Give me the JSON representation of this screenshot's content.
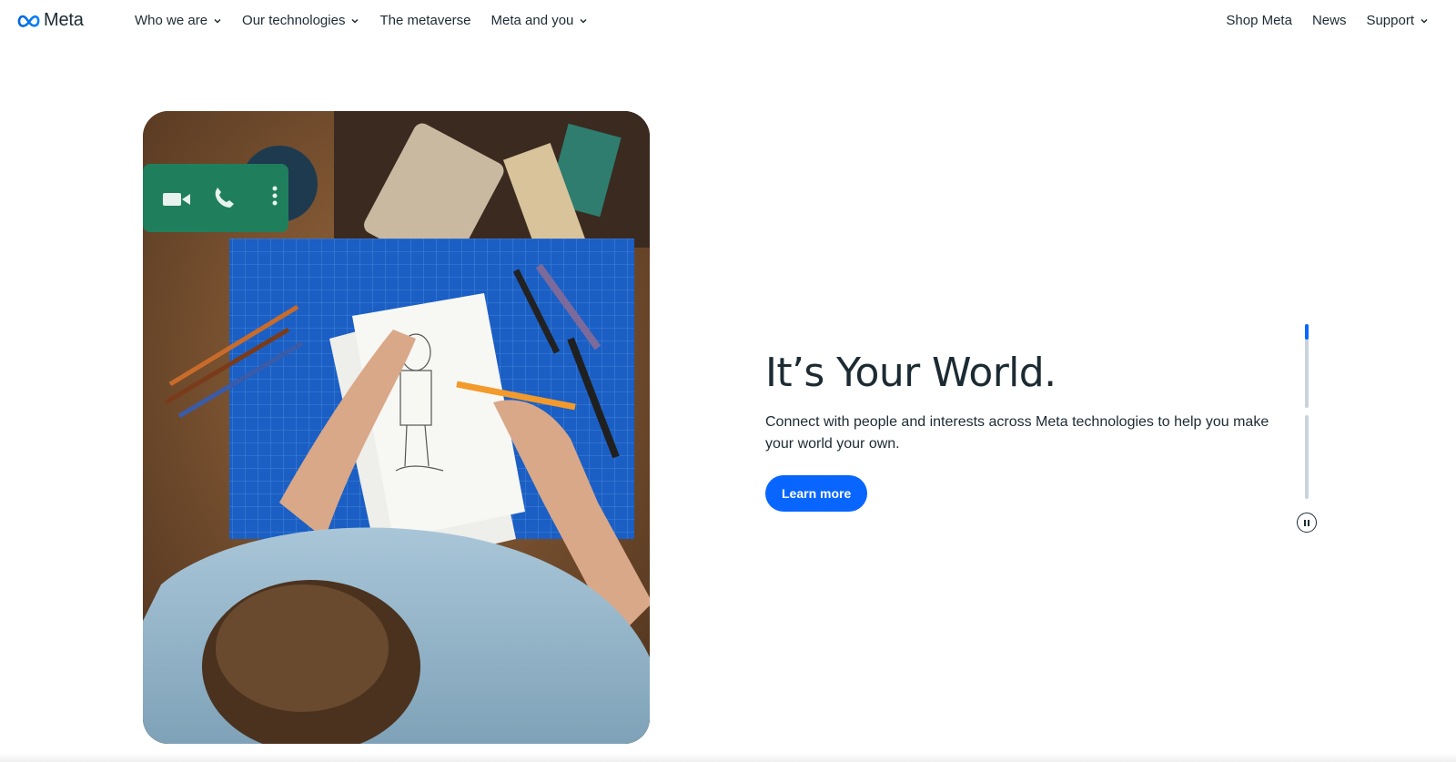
{
  "nav": {
    "logo_text": "Meta",
    "left_items": [
      {
        "label": "Who we are",
        "has_dropdown": true
      },
      {
        "label": "Our technologies",
        "has_dropdown": true
      },
      {
        "label": "The metaverse",
        "has_dropdown": false
      },
      {
        "label": "Meta and you",
        "has_dropdown": true
      }
    ],
    "right_items": [
      {
        "label": "Shop Meta",
        "has_dropdown": false
      },
      {
        "label": "News",
        "has_dropdown": false
      },
      {
        "label": "Support",
        "has_dropdown": true
      }
    ]
  },
  "hero": {
    "headline": "It’s Your World.",
    "body": "Connect with people and interests across Meta technologies to help you make your world your own.",
    "cta_label": "Learn more",
    "image_icons": [
      "video-call-icon",
      "phone-icon",
      "more-options-icon"
    ]
  },
  "carousel": {
    "slides": 2,
    "active_slide": 1,
    "active_progress": 0.18
  },
  "colors": {
    "brand_blue": "#0866ff",
    "text": "#1c2b33",
    "indicator_track": "#c9d3dc",
    "overlay_green": "#1f7f5c"
  }
}
